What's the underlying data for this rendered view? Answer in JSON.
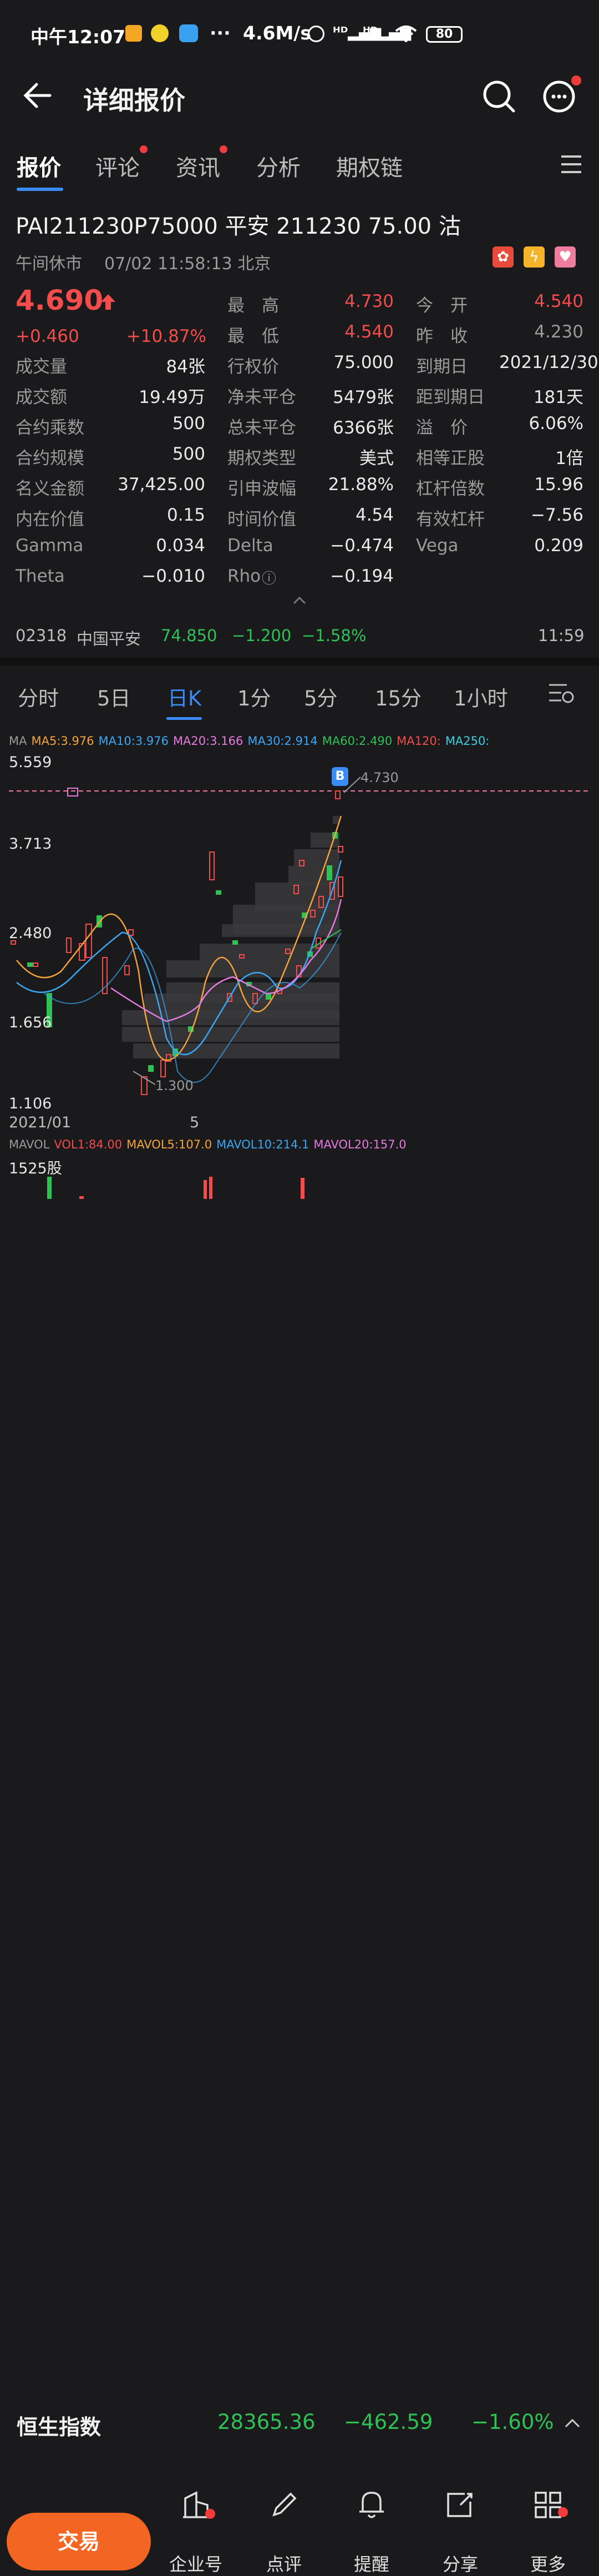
{
  "status": {
    "time": "中午12:07",
    "speed": "4.6M/s",
    "battery": "80"
  },
  "header": {
    "title": "详细报价"
  },
  "tabs": [
    {
      "label": "报价"
    },
    {
      "label": "评论"
    },
    {
      "label": "资讯"
    },
    {
      "label": "分析"
    },
    {
      "label": "期权链"
    }
  ],
  "quote": {
    "code_name": "PAI211230P75000  平安 211230 75.00 沽",
    "status": "午间休市",
    "datetime": "07/02 11:58:13 北京",
    "price": "4.690",
    "change": "+0.460",
    "change_pct": "+10.87%"
  },
  "grid": {
    "high_label": "最　高",
    "high": "4.730",
    "low_label": "最　低",
    "low": "4.540",
    "open_label": "今　开",
    "open": "4.540",
    "prev_label": "昨　收",
    "prev": "4.230",
    "rows": [
      [
        {
          "l": "成交量",
          "v": "84张"
        },
        {
          "l": "行权价",
          "v": "75.000"
        },
        {
          "l": "到期日",
          "v": "2021/12/30"
        }
      ],
      [
        {
          "l": "成交额",
          "v": "19.49万"
        },
        {
          "l": "净未平仓",
          "v": "5479张"
        },
        {
          "l": "距到期日",
          "v": "181天"
        }
      ],
      [
        {
          "l": "合约乘数",
          "v": "500"
        },
        {
          "l": "总未平仓",
          "v": "6366张"
        },
        {
          "l": "溢　价",
          "v": "6.06%"
        }
      ],
      [
        {
          "l": "合约规模",
          "v": "500"
        },
        {
          "l": "期权类型",
          "v": "美式"
        },
        {
          "l": "相等正股",
          "v": "1倍"
        }
      ],
      [
        {
          "l": "名义金额",
          "v": "37,425.00"
        },
        {
          "l": "引申波幅",
          "v": "21.88%"
        },
        {
          "l": "杠杆倍数",
          "v": "15.96"
        }
      ],
      [
        {
          "l": "内在价值",
          "v": "0.15"
        },
        {
          "l": "时间价值",
          "v": "4.54"
        },
        {
          "l": "有效杠杆",
          "v": "−7.56"
        }
      ],
      [
        {
          "l": "Gamma",
          "v": "0.034"
        },
        {
          "l": "Delta",
          "v": "−0.474"
        },
        {
          "l": "Vega",
          "v": "0.209"
        }
      ],
      [
        {
          "l": "Theta",
          "v": "−0.010"
        },
        {
          "l": "Rho",
          "v": "−0.194"
        },
        {
          "l": "",
          "v": ""
        }
      ]
    ]
  },
  "underlying": {
    "code": "02318",
    "name": "中国平安",
    "price": "74.850",
    "change": "−1.200",
    "pct": "−1.58%",
    "time": "11:59"
  },
  "chart_tabs": [
    {
      "label": "分时"
    },
    {
      "label": "5日"
    },
    {
      "label": "日K"
    },
    {
      "label": "1分"
    },
    {
      "label": "5分"
    },
    {
      "label": "15分"
    },
    {
      "label": "1小时"
    }
  ],
  "ma_line": [
    {
      "text": "MA",
      "color": "#9a9a9a"
    },
    {
      "text": "MA5:3.976",
      "color": "#f5a33a"
    },
    {
      "text": "MA10:3.976",
      "color": "#3ba7f5"
    },
    {
      "text": "MA20:3.166",
      "color": "#e57ae0"
    },
    {
      "text": "MA30:2.914",
      "color": "#3ba7f5"
    },
    {
      "text": "MA60:2.490",
      "color": "#2ec255"
    },
    {
      "text": "MA120:",
      "color": "#f24c4c"
    },
    {
      "text": "MA250:",
      "color": "#39d0e0"
    }
  ],
  "chart_data": {
    "type": "candlestick",
    "y_ticks": [
      "5.559",
      "3.713",
      "2.480",
      "1.656",
      "1.106"
    ],
    "x_ticks": [
      "2021/01",
      "5"
    ],
    "high_marker": "4.730",
    "low_marker": "1.300",
    "marker_label": "B"
  },
  "mavol_line": [
    {
      "text": "MAVOL",
      "color": "#9a9a9a"
    },
    {
      "text": "VOL1:84.00",
      "color": "#f24c4c"
    },
    {
      "text": "MAVOL5:107.0",
      "color": "#f5a33a"
    },
    {
      "text": "MAVOL10:214.1",
      "color": "#3ba7f5"
    },
    {
      "text": "MAVOL20:157.0",
      "color": "#e57ae0"
    }
  ],
  "vol_axis": "1525股",
  "index": {
    "name": "恒生指数",
    "value": "28365.36",
    "change": "−462.59",
    "pct": "−1.60%"
  },
  "nav": {
    "trade": "交易",
    "items": [
      {
        "label": "企业号"
      },
      {
        "label": "点评"
      },
      {
        "label": "提醒"
      },
      {
        "label": "分享"
      },
      {
        "label": "更多"
      }
    ]
  }
}
